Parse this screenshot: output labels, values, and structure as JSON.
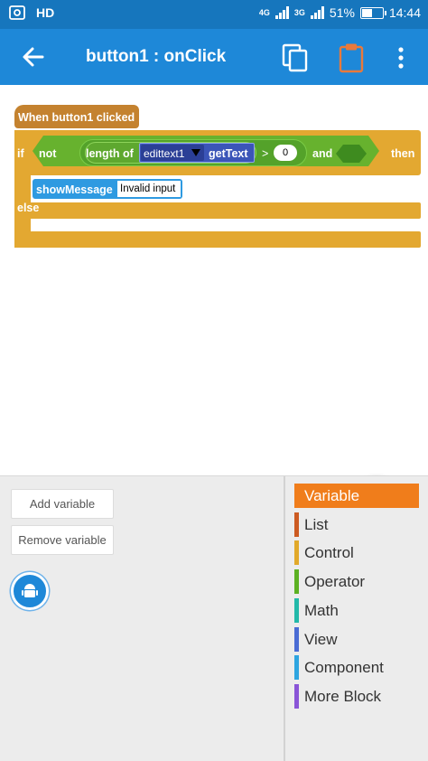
{
  "status_bar": {
    "network_label": "4G",
    "network2_label": "3G",
    "hd_label": "HD",
    "battery_percent": "51%",
    "battery_level": 0.51,
    "time": "14:44"
  },
  "app_bar": {
    "title": "button1 : onClick",
    "icons": [
      "back-arrow-icon",
      "copy-icon",
      "clipboard-icon",
      "more-vert-icon"
    ]
  },
  "blocks": {
    "event": "When button1 clicked",
    "if_label": "if",
    "not_label": "not",
    "length_label": "length of",
    "edittext_value": "edittext1",
    "get_text_label": "getText",
    "gt_symbol": ">",
    "compare_value": "0",
    "and_label": "and",
    "then_label": "then",
    "show_message_label": "showMessage",
    "message_text": "Invalid input",
    "else_label": "else"
  },
  "palette": {
    "add_variable": "Add variable",
    "remove_variable": "Remove variable",
    "categories": [
      {
        "label": "Variable",
        "color": "#f07d1b",
        "selected": true
      },
      {
        "label": "List",
        "color": "#cc5b22",
        "selected": false
      },
      {
        "label": "Control",
        "color": "#e1a92a",
        "selected": false
      },
      {
        "label": "Operator",
        "color": "#5cb122",
        "selected": false
      },
      {
        "label": "Math",
        "color": "#23b9a9",
        "selected": false
      },
      {
        "label": "View",
        "color": "#4a6cd4",
        "selected": false
      },
      {
        "label": "Component",
        "color": "#2ea5e0",
        "selected": false
      },
      {
        "label": "More Block",
        "color": "#8a55d7",
        "selected": false
      }
    ]
  },
  "colors": {
    "primary": "#1e88d8",
    "status_bar": "#1676bd",
    "event_block": "#c4822f",
    "control_block": "#e3a831",
    "operator_block": "#67b22e",
    "view_block": "#2e9ae1"
  }
}
